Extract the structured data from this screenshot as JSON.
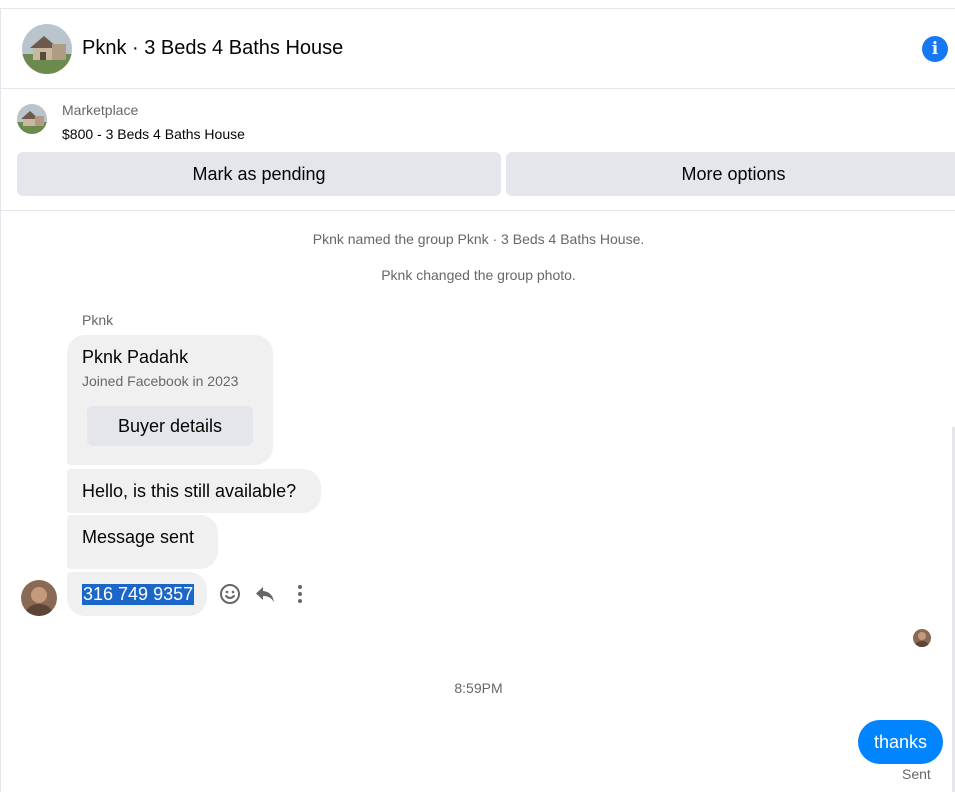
{
  "header": {
    "title": "Pknk · 3 Beds 4 Baths House",
    "info_icon": "info-icon",
    "info_glyph": "i"
  },
  "marketplace": {
    "label": "Marketplace",
    "item": "$800 - 3 Beds 4 Baths House",
    "mark_pending": "Mark as pending",
    "more_options": "More options"
  },
  "system_messages": [
    "Pknk named the group Pknk · 3 Beds 4 Baths House.",
    "Pknk changed the group photo."
  ],
  "thread": {
    "sender_name": "Pknk",
    "card": {
      "name": "Pknk Padahk",
      "joined": "Joined Facebook in 2023",
      "button": "Buyer details"
    },
    "messages": [
      "Hello, is this still available?",
      "Message sent",
      "316 749 9357"
    ],
    "timestamp": "8:59PM",
    "outgoing": "thanks",
    "sent_status": "Sent"
  },
  "colors": {
    "accent": "#0084ff",
    "info": "#1877f2",
    "bubble": "#f0f0f0",
    "button": "#e4e6eb",
    "selection": "#1a66c9"
  }
}
